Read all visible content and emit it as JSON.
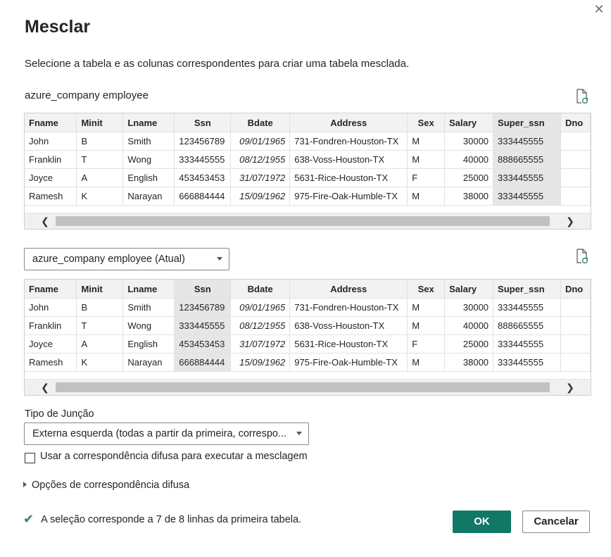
{
  "dialog": {
    "title": "Mesclar",
    "close_icon": "close-icon",
    "subtitle": "Selecione a tabela e as colunas correspondentes para criar uma tabela mesclada."
  },
  "table1": {
    "label": "azure_company employee",
    "selected_column": "Super_ssn",
    "columns": [
      "Fname",
      "Minit",
      "Lname",
      "Ssn",
      "Bdate",
      "Address",
      "Sex",
      "Salary",
      "Super_ssn",
      "Dno"
    ],
    "rows": [
      [
        "John",
        "B",
        "Smith",
        "123456789",
        "09/01/1965",
        "731-Fondren-Houston-TX",
        "M",
        "30000",
        "333445555",
        ""
      ],
      [
        "Franklin",
        "T",
        "Wong",
        "333445555",
        "08/12/1955",
        "638-Voss-Houston-TX",
        "M",
        "40000",
        "888665555",
        ""
      ],
      [
        "Joyce",
        "A",
        "English",
        "453453453",
        "31/07/1972",
        "5631-Rice-Houston-TX",
        "F",
        "25000",
        "333445555",
        ""
      ],
      [
        "Ramesh",
        "K",
        "Narayan",
        "666884444",
        "15/09/1962",
        "975-Fire-Oak-Humble-TX",
        "M",
        "38000",
        "333445555",
        ""
      ]
    ]
  },
  "table2": {
    "dropdown_value": "azure_company employee (Atual)",
    "selected_column": "Ssn",
    "columns": [
      "Fname",
      "Minit",
      "Lname",
      "Ssn",
      "Bdate",
      "Address",
      "Sex",
      "Salary",
      "Super_ssn",
      "Dno"
    ],
    "rows": [
      [
        "John",
        "B",
        "Smith",
        "123456789",
        "09/01/1965",
        "731-Fondren-Houston-TX",
        "M",
        "30000",
        "333445555",
        ""
      ],
      [
        "Franklin",
        "T",
        "Wong",
        "333445555",
        "08/12/1955",
        "638-Voss-Houston-TX",
        "M",
        "40000",
        "888665555",
        ""
      ],
      [
        "Joyce",
        "A",
        "English",
        "453453453",
        "31/07/1972",
        "5631-Rice-Houston-TX",
        "F",
        "25000",
        "333445555",
        ""
      ],
      [
        "Ramesh",
        "K",
        "Narayan",
        "666884444",
        "15/09/1962",
        "975-Fire-Oak-Humble-TX",
        "M",
        "38000",
        "333445555",
        ""
      ]
    ]
  },
  "join": {
    "label": "Tipo de Junção",
    "value": "Externa esquerda (todas a partir da primeira, correspo..."
  },
  "fuzzy": {
    "checkbox_label": "Usar a correspondência difusa para executar a mesclagem",
    "checked": false,
    "options_label": "Opções de correspondência difusa"
  },
  "status": {
    "text": "A seleção corresponde a 7 de 8 linhas da primeira tabela."
  },
  "buttons": {
    "ok": "OK",
    "cancel": "Cancelar"
  },
  "colors": {
    "primary": "#117865",
    "success_check": "#2d8a5f",
    "selected_column": "#e6e6e6"
  }
}
